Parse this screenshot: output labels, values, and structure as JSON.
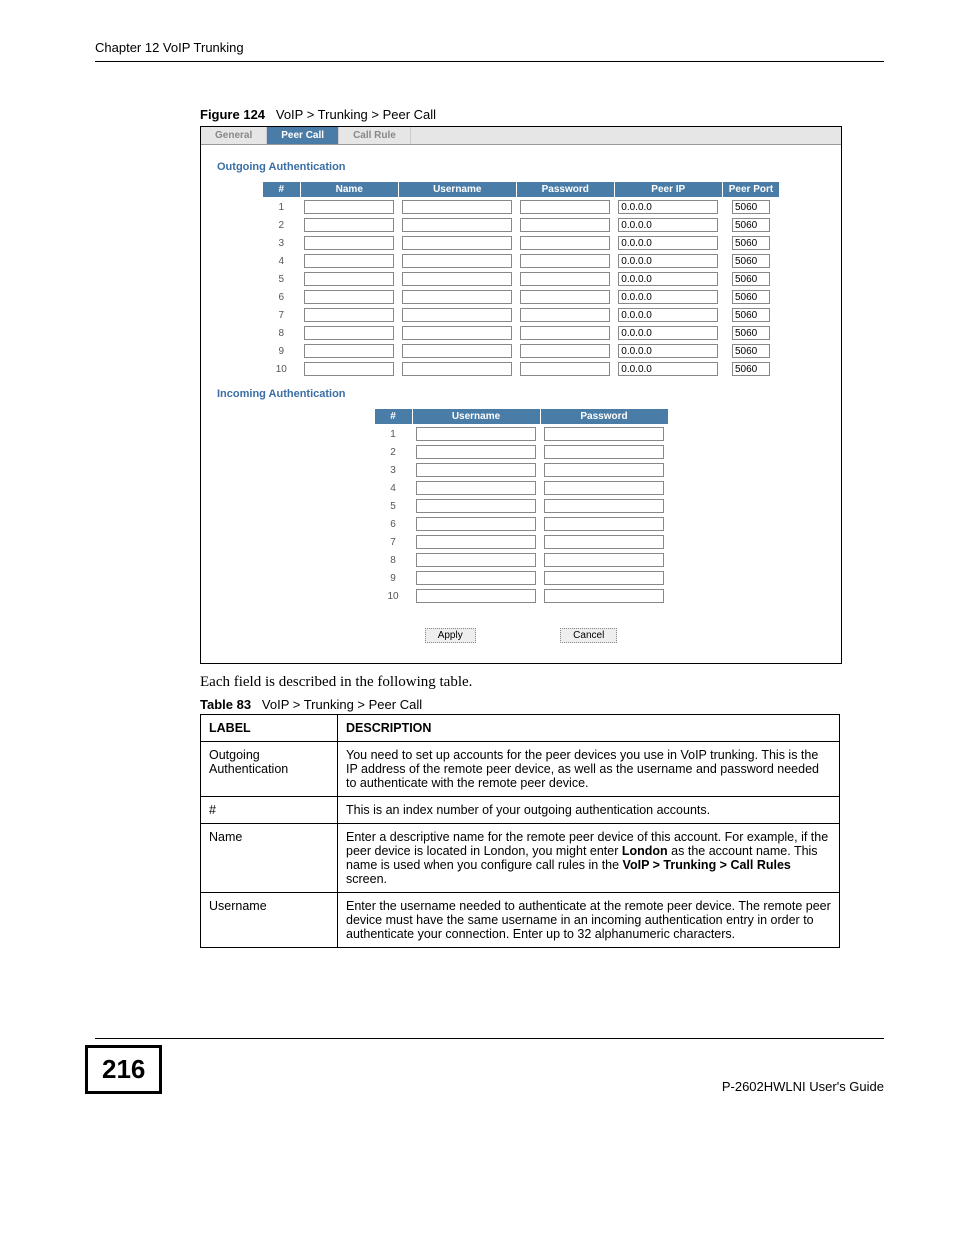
{
  "header": {
    "chapter": "Chapter 12 VoIP Trunking"
  },
  "figure": {
    "label": "Figure 124",
    "title": "VoIP > Trunking  > Peer Call"
  },
  "tabs": {
    "general": "General",
    "peer_call": "Peer Call",
    "call_rule": "Call Rule"
  },
  "sections": {
    "outgoing_title": "Outgoing Authentication",
    "incoming_title": "Incoming Authentication"
  },
  "headers": {
    "idx": "#",
    "name": "Name",
    "username": "Username",
    "password": "Password",
    "peer_ip": "Peer IP",
    "peer_port": "Peer Port"
  },
  "outgoing_rows": [
    {
      "n": "1",
      "name": "",
      "user": "",
      "pass": "",
      "ip": "0.0.0.0",
      "port": "5060"
    },
    {
      "n": "2",
      "name": "",
      "user": "",
      "pass": "",
      "ip": "0.0.0.0",
      "port": "5060"
    },
    {
      "n": "3",
      "name": "",
      "user": "",
      "pass": "",
      "ip": "0.0.0.0",
      "port": "5060"
    },
    {
      "n": "4",
      "name": "",
      "user": "",
      "pass": "",
      "ip": "0.0.0.0",
      "port": "5060"
    },
    {
      "n": "5",
      "name": "",
      "user": "",
      "pass": "",
      "ip": "0.0.0.0",
      "port": "5060"
    },
    {
      "n": "6",
      "name": "",
      "user": "",
      "pass": "",
      "ip": "0.0.0.0",
      "port": "5060"
    },
    {
      "n": "7",
      "name": "",
      "user": "",
      "pass": "",
      "ip": "0.0.0.0",
      "port": "5060"
    },
    {
      "n": "8",
      "name": "",
      "user": "",
      "pass": "",
      "ip": "0.0.0.0",
      "port": "5060"
    },
    {
      "n": "9",
      "name": "",
      "user": "",
      "pass": "",
      "ip": "0.0.0.0",
      "port": "5060"
    },
    {
      "n": "10",
      "name": "",
      "user": "",
      "pass": "",
      "ip": "0.0.0.0",
      "port": "5060"
    }
  ],
  "incoming_rows": [
    {
      "n": "1",
      "user": "",
      "pass": ""
    },
    {
      "n": "2",
      "user": "",
      "pass": ""
    },
    {
      "n": "3",
      "user": "",
      "pass": ""
    },
    {
      "n": "4",
      "user": "",
      "pass": ""
    },
    {
      "n": "5",
      "user": "",
      "pass": ""
    },
    {
      "n": "6",
      "user": "",
      "pass": ""
    },
    {
      "n": "7",
      "user": "",
      "pass": ""
    },
    {
      "n": "8",
      "user": "",
      "pass": ""
    },
    {
      "n": "9",
      "user": "",
      "pass": ""
    },
    {
      "n": "10",
      "user": "",
      "pass": ""
    }
  ],
  "buttons": {
    "apply": "Apply",
    "cancel": "Cancel"
  },
  "body_text": "Each field is described in the following table.",
  "table_caption": {
    "label": "Table 83",
    "title": "VoIP > Trunking > Peer Call"
  },
  "desc_table": {
    "head_label": "LABEL",
    "head_desc": "DESCRIPTION",
    "rows": [
      {
        "label": "Outgoing Authentication",
        "desc": "You need to set up accounts for the peer devices you use in VoIP trunking. This is the IP address of the remote peer device, as well as the username and password needed to authenticate with the remote peer device."
      },
      {
        "label": "#",
        "desc": "This is an index number of your outgoing authentication accounts."
      },
      {
        "label": "Name",
        "desc_html": "Enter a descriptive name for the remote peer device of this account. For example, if the peer device is located in London, you might enter <b>London</b> as the account name. This name is used when you configure call rules in the <b>VoIP > Trunking > Call Rules</b> screen."
      },
      {
        "label": "Username",
        "desc": "Enter the username needed to authenticate at the remote peer device. The remote peer device must have the same username in an incoming authentication entry in order to authenticate your connection. Enter up to 32 alphanumeric characters."
      }
    ]
  },
  "footer": {
    "page": "216",
    "guide": "P-2602HWLNI User's Guide"
  }
}
